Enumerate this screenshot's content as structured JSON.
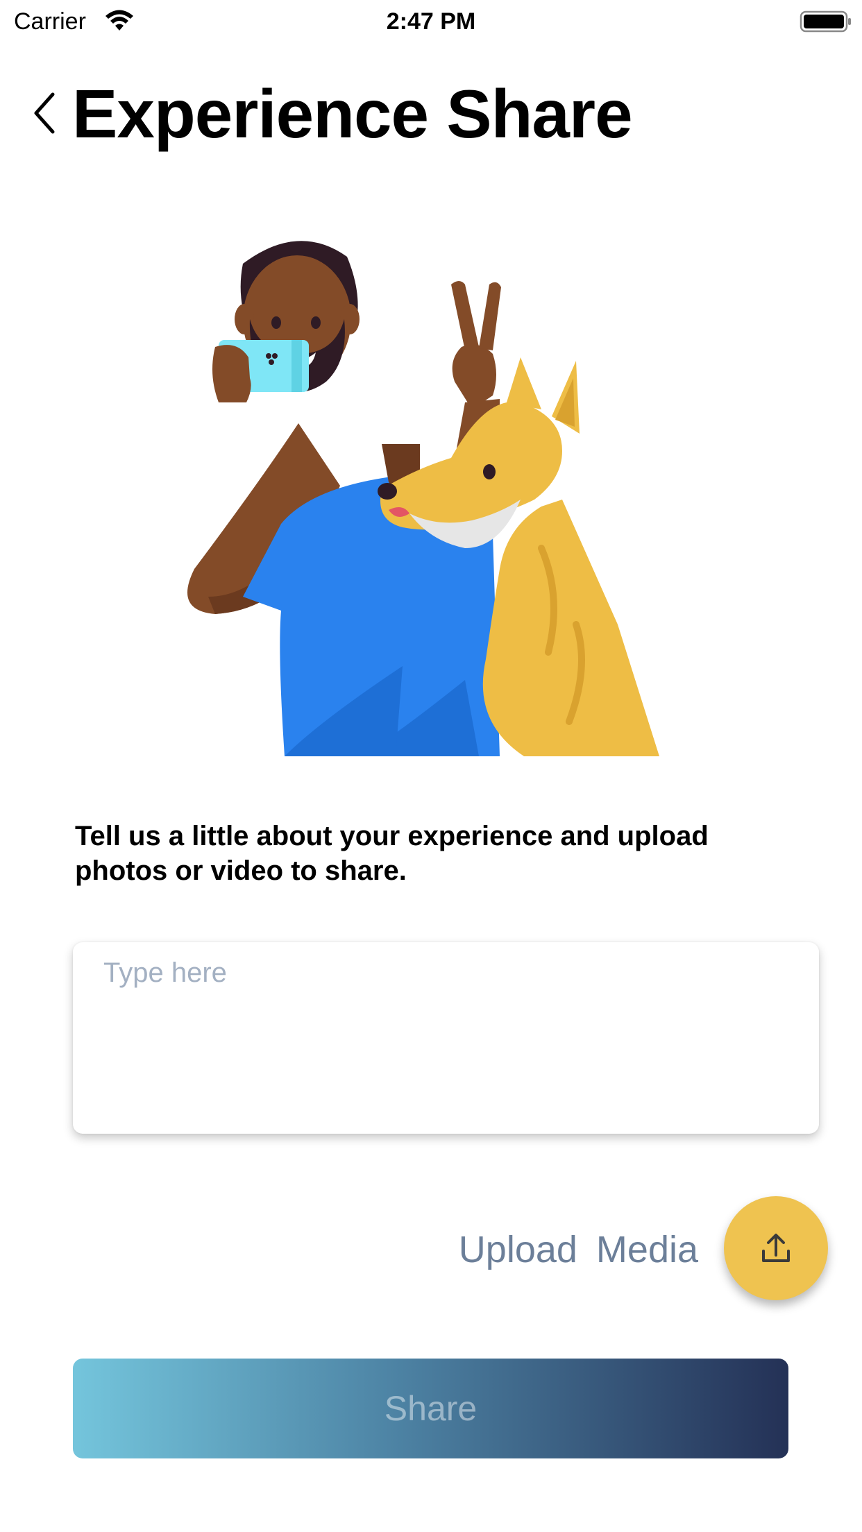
{
  "status_bar": {
    "carrier": "Carrier",
    "time": "2:47 PM",
    "icons": [
      "wifi-icon",
      "battery-icon"
    ]
  },
  "nav": {
    "back_icon": "chevron-left-icon",
    "title": "Experience Share"
  },
  "illustration": {
    "subject": "person-taking-selfie-with-dog-illustration",
    "colors": {
      "shirt": "#2a82ee",
      "skin": "#834b28",
      "hair": "#2f1b25",
      "phone": "#7fe6f6",
      "dog": "#eebd45"
    }
  },
  "content": {
    "instructions": "Tell us a little about your experience and upload photos or video to share.",
    "input": {
      "placeholder": "Type here",
      "value": ""
    }
  },
  "upload": {
    "label": "Upload Media",
    "icon": "upload-icon",
    "color": "#efc350"
  },
  "share": {
    "label": "Share",
    "gradient": [
      "#74c5dc",
      "#4d83a4",
      "#243156"
    ]
  }
}
